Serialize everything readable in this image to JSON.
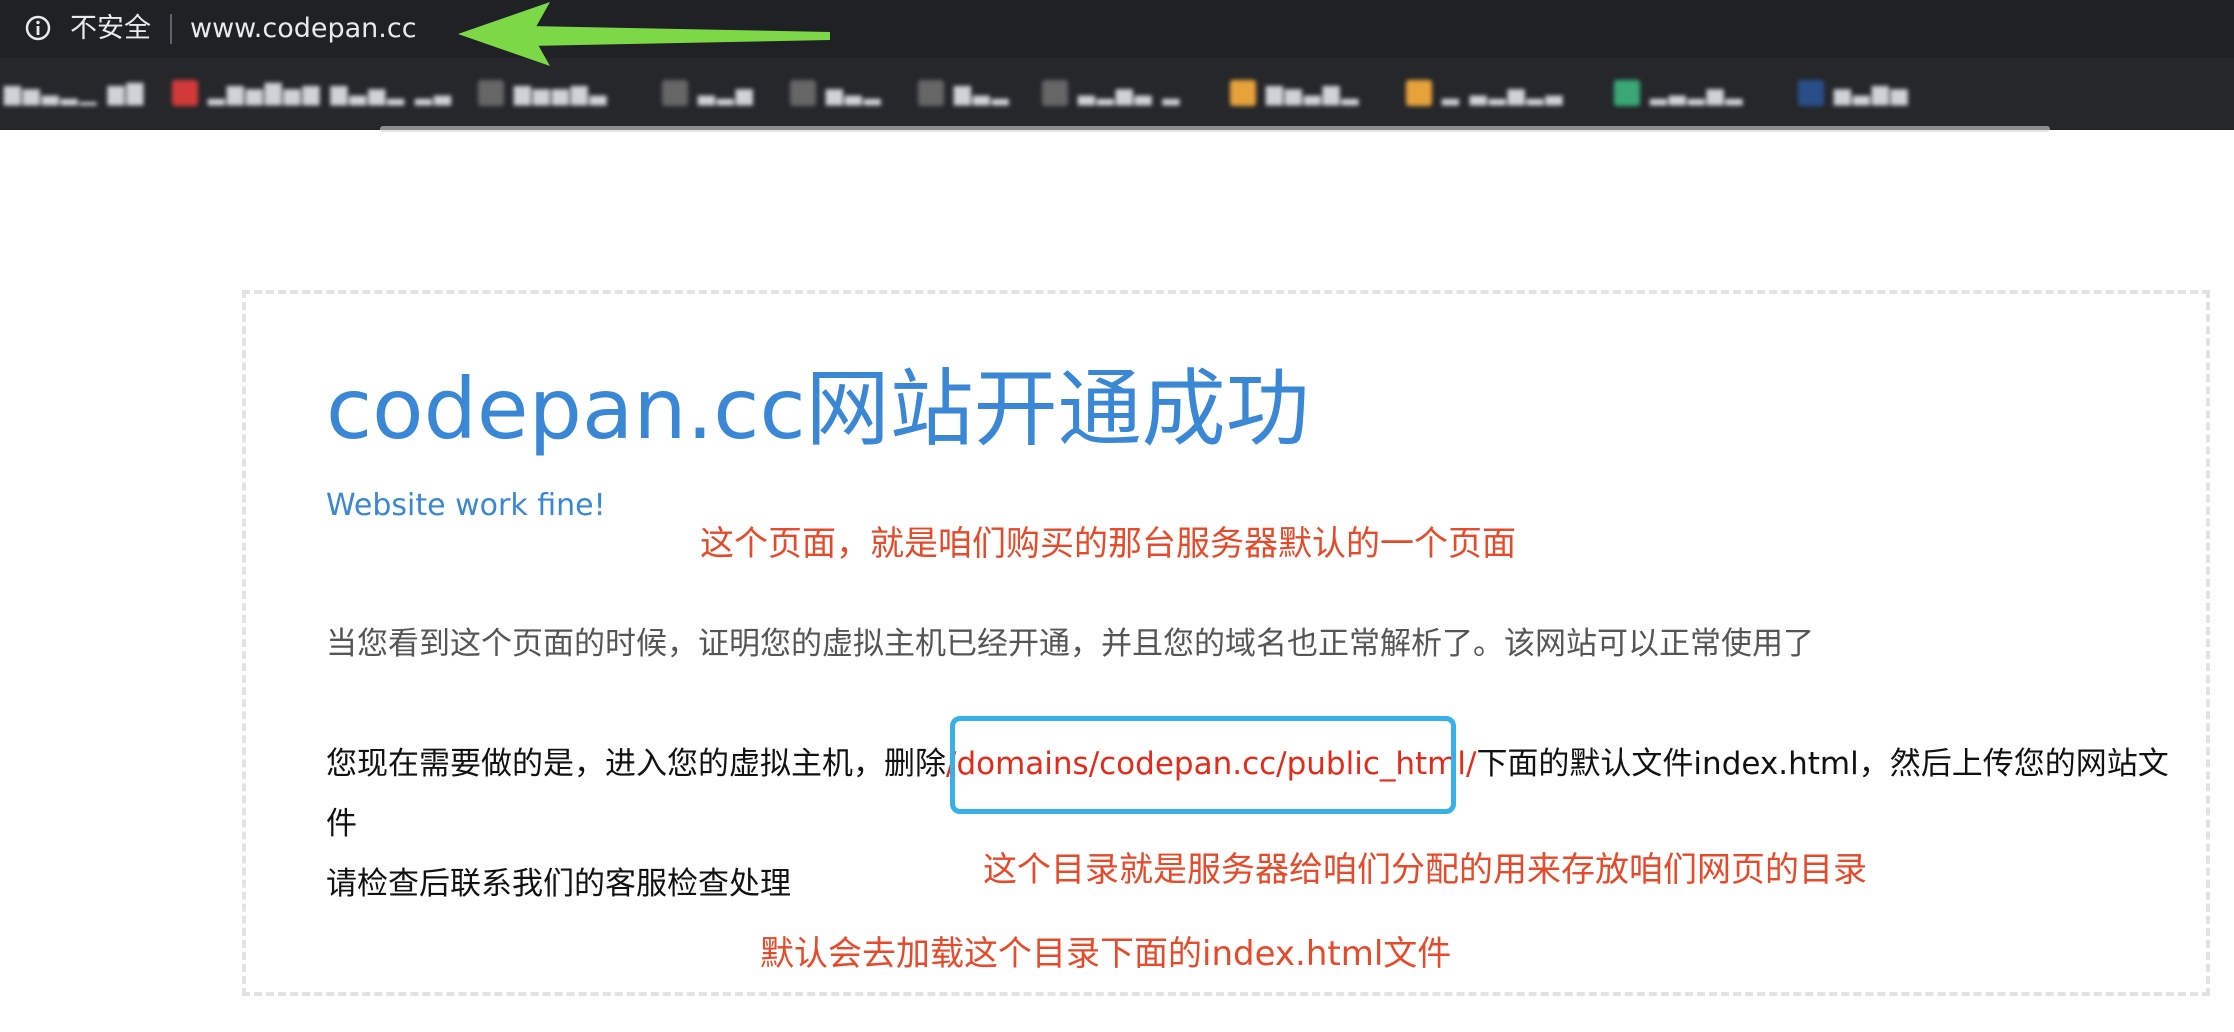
{
  "browser": {
    "security_label": "不安全",
    "url": "www.codepan.cc",
    "bookmarks": [
      {
        "label": "▆▅▃▂▁ ▆▇",
        "icon": "blurred-bookmark-icon",
        "color": "#888888"
      },
      {
        "label": "▂▆▅▇▅▆ ▆▃▅▂ ▂▃",
        "icon": "red-bookmark-icon",
        "color": "#d23a3a"
      },
      {
        "label": "▆▅▅▆▃",
        "icon": "gray-bookmark-icon",
        "color": "#666666"
      },
      {
        "label": "▃▂▅",
        "icon": "gray-bookmark-icon",
        "color": "#666666"
      },
      {
        "label": "▅▃▂",
        "icon": "gray-bookmark-icon",
        "color": "#666666"
      },
      {
        "label": "▆▃▂",
        "icon": "gray-bookmark-icon",
        "color": "#666666"
      },
      {
        "label": "▃▂▅▃ ▂",
        "icon": "gray-bookmark-icon",
        "color": "#666666"
      },
      {
        "label": "▆▅▃▆▂",
        "icon": "orange-bookmark-icon",
        "color": "#e8a23a"
      },
      {
        "label": "▂ ▃▂▅▂▃",
        "icon": "orange-bookmark-icon",
        "color": "#e8a23a"
      },
      {
        "label": "▂▃▂▅▂",
        "icon": "green-bookmark-icon",
        "color": "#3aa876"
      },
      {
        "label": "▅▃▆▅",
        "icon": "blue-bookmark-icon",
        "color": "#2a4e8a"
      }
    ]
  },
  "page": {
    "title": "codepan.cc网站开通成功",
    "subtitle": "Website work fine!",
    "paragraph_1": "当您看到这个页面的时候，证明您的虚拟主机已经开通，并且您的域名也正常解析了。该网站可以正常使用了",
    "paragraph_2_prefix": "您现在需要做的是，进入您的虚拟主机，删除",
    "paragraph_2_path": "/domains/codepan.cc/public_html/",
    "paragraph_2_suffix": "下面的默认文件index.html，然后上传您的网站文",
    "paragraph_2_wrap": "件",
    "paragraph_3": "请检查后联系我们的客服检查处理"
  },
  "annotations": {
    "note_page": "这个页面，就是咱们购买的那台服务器默认的一个页面",
    "note_directory": "这个目录就是服务器给咱们分配的用来存放咱们网页的目录",
    "note_default_file": "默认会去加载这个目录下面的index.html文件"
  },
  "colors": {
    "title_blue": "#3a87d5",
    "annotation_red": "#e64a2a",
    "path_red": "#e62a1a",
    "highlight_blue": "#38b0e8",
    "arrow_green": "#7dd848"
  }
}
